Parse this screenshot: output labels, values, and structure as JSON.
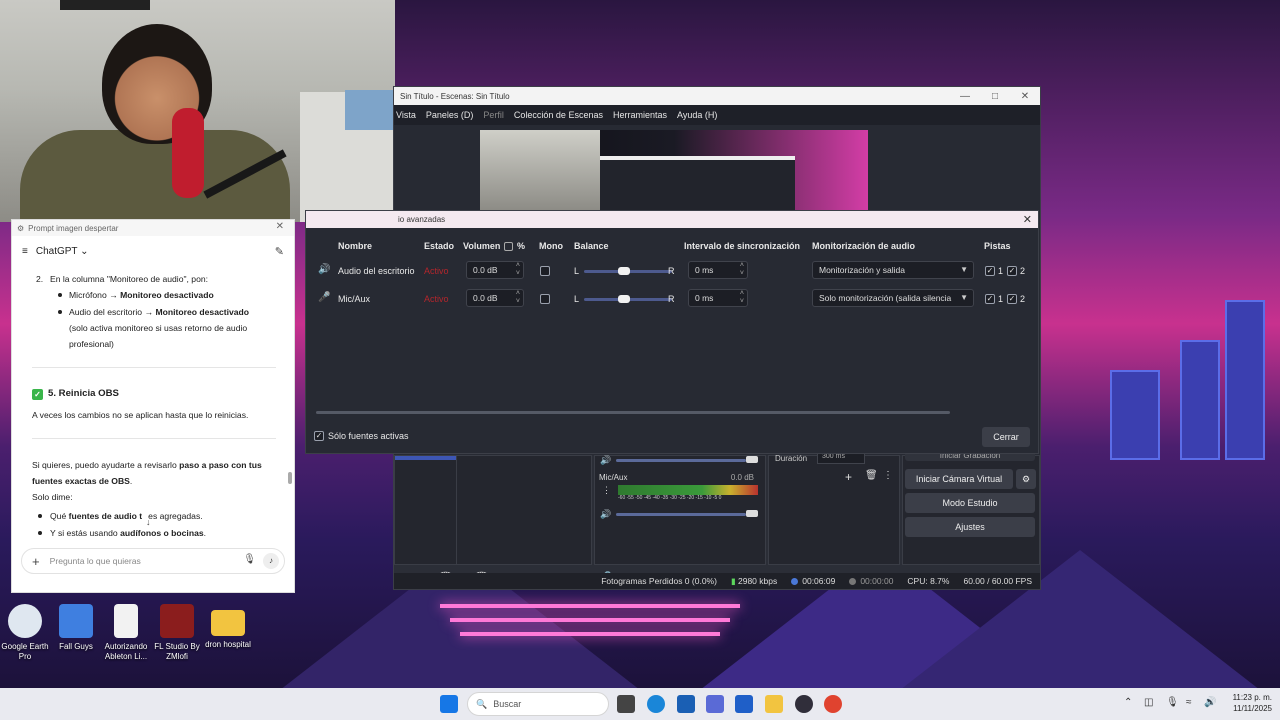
{
  "obs": {
    "title": "Sin Título - Escenas: Sin Título",
    "menu": [
      "Vista",
      "Paneles (D)",
      "Perfil",
      "Colección de Escenas",
      "Herramientas",
      "Ayuda (H)"
    ],
    "mixer": {
      "source_label": "Mic/Aux",
      "level": "0.0 dB",
      "scale": "-60 -55 -50 -45 -40 -35 -30 -25 -20 -15 -10 -5 0"
    },
    "transition_duration_label": "Duración",
    "transition_duration": "300 ms",
    "controls": {
      "start_recording": "Iniciar Grabación",
      "virtual_cam": "Iniciar Cámara Virtual",
      "studio_mode": "Modo Estudio",
      "settings": "Ajustes"
    },
    "status": {
      "dropped": "Fotogramas Perdidos 0 (0.0%)",
      "bitrate": "2980 kbps",
      "stream_time": "00:06:09",
      "rec_time": "00:00:00",
      "cpu": "CPU: 8.7%",
      "fps": "60.00 / 60.00 FPS"
    }
  },
  "advanced_audio": {
    "title": "io avanzadas",
    "columns": {
      "name": "Nombre",
      "status": "Estado",
      "volume": "Volumen",
      "percent": "%",
      "mono": "Mono",
      "balance": "Balance",
      "sync": "Intervalo de sincronización",
      "monitor": "Monitorización de audio",
      "tracks": "Pistas"
    },
    "rows": [
      {
        "name": "Audio del escritorio",
        "status": "Activo",
        "volume": "0.0 dB",
        "balance_left": "L",
        "balance_right": "R",
        "balance_position": 0.5,
        "sync": "0 ms",
        "monitor": "Monitorización y salida",
        "track1": "1",
        "track2": "2"
      },
      {
        "name": "Mic/Aux",
        "status": "Activo",
        "volume": "0.0 dB",
        "balance_left": "L",
        "balance_right": "R",
        "balance_position": 0.5,
        "sync": "0 ms",
        "monitor": "Solo monitorización (salida silencia",
        "track1": "1",
        "track2": "2"
      }
    ],
    "only_active_label": "Sólo fuentes activas",
    "close_label": "Cerrar"
  },
  "chat": {
    "window_title": "Prompt imagen despertar",
    "app_name": "ChatGPT",
    "item2_num": "2.",
    "item2_text": "En la columna \"Monitoreo de audio\", pon:",
    "bullet1_a": "Micrófono → ",
    "bullet1_b": "Monitoreo desactivado",
    "bullet2_a": "Audio del escritorio → ",
    "bullet2_b": "Monitoreo desactivado",
    "bullet2_c": "(solo activa monitoreo si usas retorno de audio",
    "bullet2_d": "profesional)",
    "heading5": "5. Reinicia OBS",
    "restart_text": "A veces los cambios no se aplican hasta que lo reinicias.",
    "offer_a": "Si quieres, puedo ayudarte a revisarlo ",
    "offer_b": "paso a paso con tus",
    "offer_c": "fuentes exactas de OBS",
    "offer_d": ".",
    "tell_me": "Solo dime:",
    "q1_a": "Qué ",
    "q1_b": "fuentes de audio t",
    "q1_c": "es agregadas.",
    "q2_a": "Y si estás usando ",
    "q2_b": "audífonos o bocinas",
    "q2_c": ".",
    "input_placeholder": "Pregunta lo que quieras"
  },
  "desktop_icons": [
    {
      "label": "Google Earth Pro",
      "color": "#dfe7f0"
    },
    {
      "label": "Fall Guys",
      "color": "#3f7fe0"
    },
    {
      "label": "Autorizando Ableton Li...",
      "color": "#f2f2f2"
    },
    {
      "label": "FL Studio By ZMlofi",
      "color": "#8b1d1d"
    },
    {
      "label": "dron hospital",
      "color": "#f2c440"
    }
  ],
  "taskbar": {
    "search_placeholder": "Buscar",
    "time": "11:23 p. m.",
    "date": "11/11/2025"
  },
  "colors": {
    "obs_bg": "#272a33",
    "active_red": "#b3262c",
    "accent_pink": "#d33da6"
  }
}
